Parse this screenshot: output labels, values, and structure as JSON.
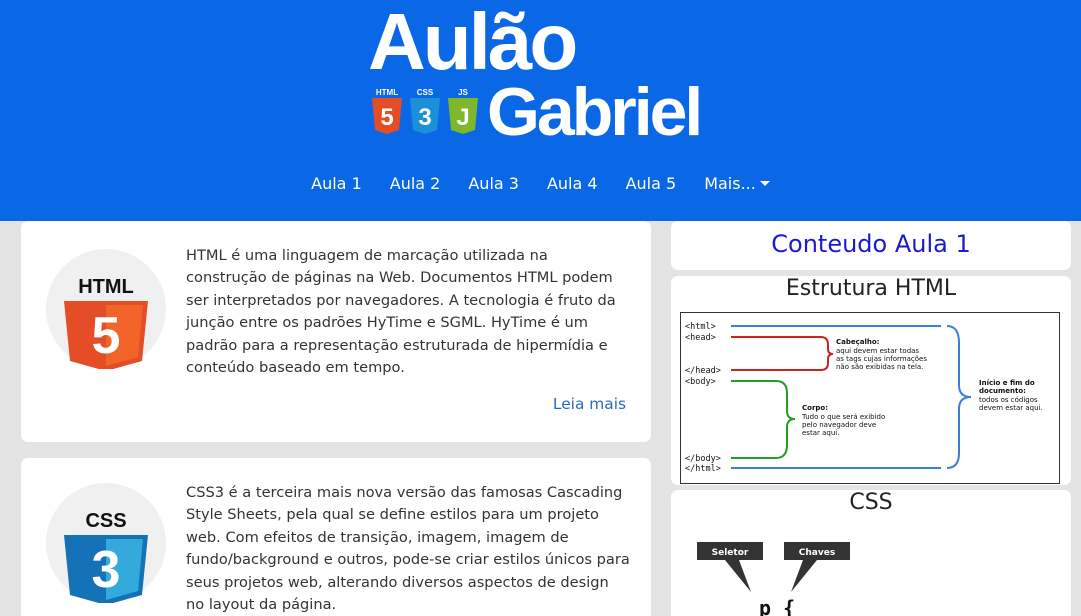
{
  "header": {
    "logo_line1": "Aulão",
    "logo_line2": "Gabriel",
    "badges": [
      "HTML",
      "CSS",
      "JS"
    ],
    "badge_digits": [
      "5",
      "3",
      "J"
    ],
    "bg_color": "#0a68e6"
  },
  "nav": {
    "items": [
      "Aula 1",
      "Aula 2",
      "Aula 3",
      "Aula 4",
      "Aula 5"
    ],
    "more_label": "Mais..."
  },
  "cards": [
    {
      "icon": "html5-icon",
      "icon_label": "HTML",
      "icon_digit": "5",
      "text": "HTML é uma linguagem de marcação utilizada na construção de páginas na Web. Documentos HTML podem ser interpretados por navegadores. A tecnologia é fruto da junção entre os padrões HyTime e SGML. HyTime é um padrão para a representação estruturada de hipermídia e conteúdo baseado em tempo.",
      "read_more": "Leia mais"
    },
    {
      "icon": "css3-icon",
      "icon_label": "CSS",
      "icon_digit": "3",
      "text": "CSS3 é a terceira mais nova versão das famosas Cascading Style Sheets, pela qual se define estilos para um projeto web. Com efeitos de transição, imagem, imagem de fundo/background e outros, pode-se criar estilos únicos para seus projetos web, alterando diversos aspectos de design no layout da página."
    }
  ],
  "sidebar": {
    "content_title": "Conteudo Aula 1",
    "html_title": "Estrutura HTML",
    "css_title": "CSS",
    "diagram": {
      "tags": [
        "<html>",
        "<head>",
        "</head>",
        "<body>",
        "</body>",
        "</html>"
      ],
      "head_title": "Cabeçalho:",
      "head_desc": [
        "aqui devem estar todas",
        "as tags cujas informações",
        "não são exibidas na tela."
      ],
      "body_title": "Corpo:",
      "body_desc": [
        "Tudo o que será exibido",
        "pelo navegador deve",
        "estar aqui."
      ],
      "doc_title": [
        "Início e fim do",
        "documento:"
      ],
      "doc_desc": [
        "todos os códigos",
        "devem estar aqui."
      ]
    },
    "css_labels": [
      "Seletor",
      "Chaves"
    ],
    "css_code": "p {"
  }
}
